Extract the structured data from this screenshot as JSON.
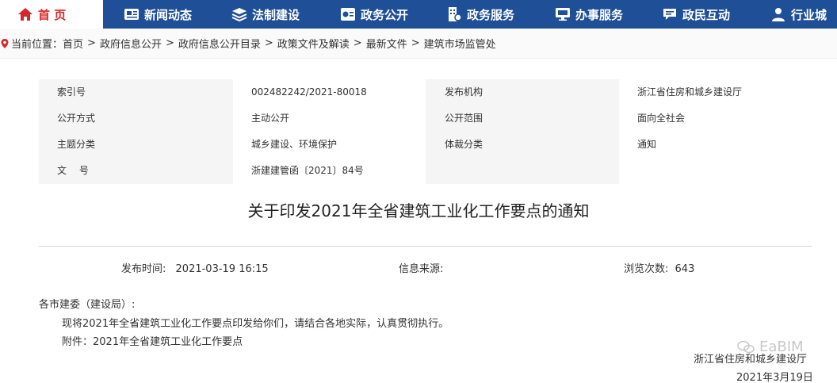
{
  "nav": {
    "home": "首 页",
    "items": [
      "新闻动态",
      "法制建设",
      "政务公开",
      "政务服务",
      "办事服务",
      "政民互动",
      "行业城"
    ]
  },
  "breadcrumb": {
    "prefix": "当前位置：",
    "items": [
      "首页",
      "政府信息公开",
      "政府信息公开目录",
      "政策文件及解读",
      "最新文件",
      "建筑市场监管处"
    ],
    "separator": ">"
  },
  "meta": {
    "index_label": "索引号",
    "index_value": "002482242/2021-80018",
    "publisher_label": "发布机构",
    "publisher_value": "浙江省住房和城乡建设厅",
    "open_mode_label": "公开方式",
    "open_mode_value": "主动公开",
    "open_scope_label": "公开范围",
    "open_scope_value": "面向全社会",
    "topic_label": "主题分类",
    "topic_value": "城乡建设、环境保护",
    "genre_label": "体裁分类",
    "genre_value": "通知",
    "docno_label": "文　 号",
    "docno_value": "浙建建管函〔2021〕84号"
  },
  "article": {
    "title": "关于印发2021年全省建筑工业化工作要点的通知",
    "publish_time_label": "发布时间:",
    "publish_time": "2021-03-19 16:15",
    "source_label": "信息来源:",
    "views_label": "浏览次数:",
    "views": "643",
    "salutation": "各市建委（建设局）:",
    "paragraph": "现将2021年全省建筑工业化工作要点印发给你们，请结合各地实际，认真贯彻执行。",
    "attachment": "附件：2021年全省建筑工业化工作要点",
    "signature_org": "浙江省住房和城乡建设厅",
    "signature_date": "2021年3月19日"
  },
  "watermark": {
    "text": "EaBIM"
  },
  "colors": {
    "nav_bg": "#1f4f96",
    "home_accent": "#d6282a",
    "meta_bg": "#f5f5f5"
  }
}
